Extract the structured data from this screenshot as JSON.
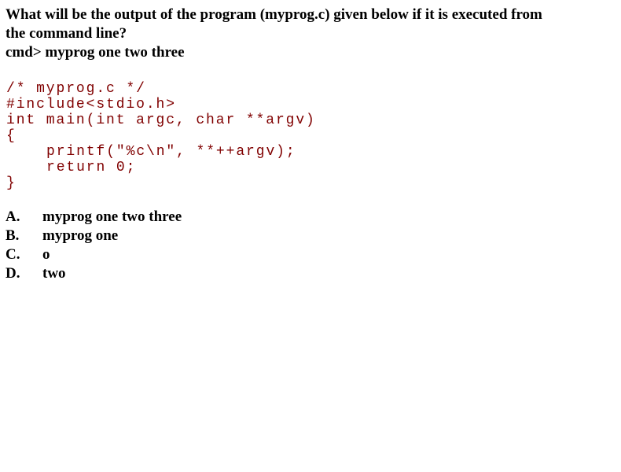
{
  "question": {
    "lines": [
      "What will be the output of the program (myprog.c) given below if it is executed from",
      "the command line?",
      "cmd> myprog one two three"
    ]
  },
  "code": {
    "lines": [
      "/* myprog.c */",
      "#include<stdio.h>",
      "int main(int argc, char **argv)",
      "{",
      "printf(\"%c\\n\", **++argv);",
      "return 0;",
      "}"
    ]
  },
  "options": [
    {
      "letter": "A.",
      "text": "myprog one two three"
    },
    {
      "letter": "B.",
      "text": "myprog one"
    },
    {
      "letter": "C.",
      "text": "o"
    },
    {
      "letter": "D.",
      "text": "two"
    }
  ]
}
